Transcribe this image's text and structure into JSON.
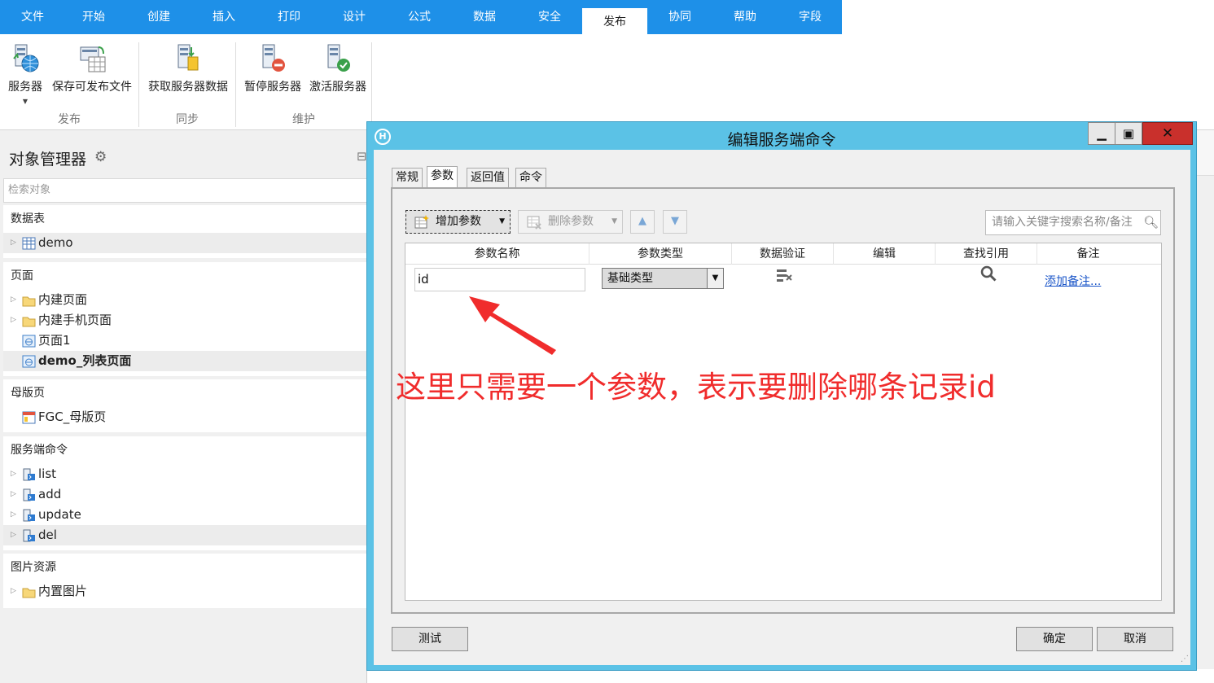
{
  "ribbon": {
    "tabs": [
      "文件",
      "开始",
      "创建",
      "插入",
      "打印",
      "设计",
      "公式",
      "数据",
      "安全",
      "发布",
      "协同",
      "帮助",
      "字段"
    ],
    "active_tab": "发布",
    "buttons": {
      "server": "服务器",
      "save_publishable": "保存可发布文件",
      "fetch_server_data": "获取服务器数据",
      "pause_server": "暂停服务器",
      "activate_server": "激活服务器"
    },
    "groups": {
      "publish": "发布",
      "sync": "同步",
      "maintain": "维护"
    }
  },
  "object_manager": {
    "title": "对象管理器",
    "search_placeholder": "检索对象",
    "sections": {
      "tables": {
        "title": "数据表",
        "items": [
          "demo"
        ]
      },
      "pages": {
        "title": "页面",
        "items": [
          "内建页面",
          "内建手机页面",
          "页面1",
          "demo_列表页面"
        ]
      },
      "master": {
        "title": "母版页",
        "items": [
          "FGC_母版页"
        ]
      },
      "commands": {
        "title": "服务端命令",
        "items": [
          "list",
          "add",
          "update",
          "del"
        ]
      },
      "images": {
        "title": "图片资源",
        "items": [
          "内置图片"
        ]
      }
    }
  },
  "dialog": {
    "title": "编辑服务端命令",
    "logo": "H",
    "tabs": [
      "常规",
      "参数",
      "返回值",
      "命令"
    ],
    "active_tab": "参数",
    "toolbar": {
      "add": "增加参数",
      "delete": "删除参数"
    },
    "search_placeholder": "请输入关键字搜索名称/备注",
    "columns": [
      "参数名称",
      "参数类型",
      "数据验证",
      "编辑",
      "查找引用",
      "备注"
    ],
    "row": {
      "name": "id",
      "type": "基础类型",
      "note_link": "添加备注..."
    },
    "annotation": "这里只需要一个参数，表示要删除哪条记录id",
    "buttons": {
      "test": "测试",
      "ok": "确定",
      "cancel": "取消"
    },
    "colors": {
      "frame": "#5bc2e6",
      "annotation": "#f02c2c"
    }
  }
}
